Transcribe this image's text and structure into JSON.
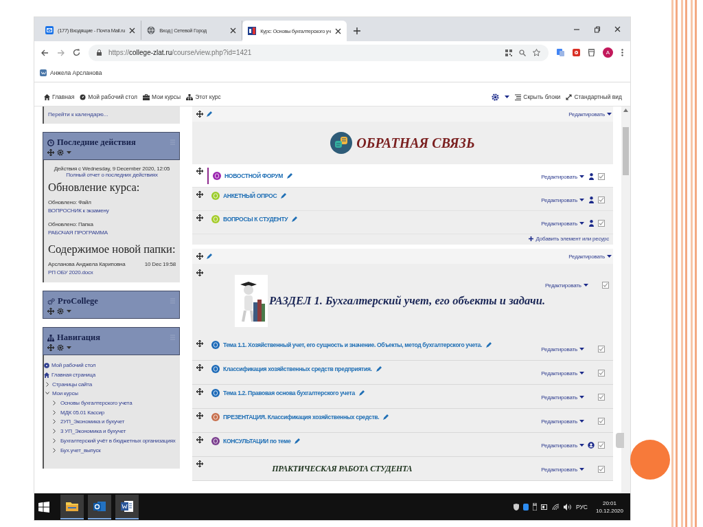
{
  "browser": {
    "tabs": [
      {
        "title": "(177) Входящие - Почта Mail.ru",
        "selected": false
      },
      {
        "title": "Вход | Сетевой Город",
        "selected": false
      },
      {
        "title": "Курс: Основы бухгалтерского уч",
        "selected": true
      }
    ],
    "url": {
      "scheme": "https://",
      "host": "college-zlat.ru",
      "path": "/course/view.php?id=1421"
    },
    "profile_initial": "A",
    "bookmarks": [
      "Анжела Арсланова"
    ]
  },
  "moodle_nav": {
    "items": [
      "Главная",
      "Мой рабочий стол",
      "Мои курсы",
      "Этот курс"
    ],
    "actions": [
      "Скрыть блоки",
      "Стандартный вид"
    ]
  },
  "sidebar": {
    "calendar_link": "Перейти к календарю...",
    "blocks": [
      {
        "kind": "recent",
        "title": "Последние действия",
        "since": "Действия с Wednesday, 9 December 2020, 12:05",
        "report_link": "Полный отчет о последних действиях",
        "heading": "Обновление курса:",
        "updates": [
          {
            "label": "Обновлено: Файл",
            "link": "ВОПРОСНИК к экзамену"
          },
          {
            "label": "Обновлено: Папка",
            "link": "РАБОЧАЯ ПРОГРАММА"
          }
        ],
        "folder_heading": "Содержимое новой папки:",
        "file": {
          "author": "Арсланова Анджела Кариповна",
          "time": "10 Dec 19:58",
          "link": "РП ОБУ 2020.docx"
        }
      },
      {
        "kind": "plain",
        "title": "ProCollege"
      },
      {
        "kind": "navigation",
        "title": "Навигация",
        "items": [
          {
            "label": "Мой рабочий стол"
          },
          {
            "label": "Главная страница"
          },
          {
            "label": "Страницы сайта",
            "expanded": false
          },
          {
            "label": "Мои курсы",
            "expanded": true,
            "children": [
              {
                "label": "Основы бухгалтерского учета",
                "expanded": false
              },
              {
                "label": "МДК 05.01 Кассир",
                "expanded": false
              },
              {
                "label": "2УП_Экономика и бухучет",
                "expanded": false
              },
              {
                "label": "3 УП_Экономика и бухучет",
                "expanded": false
              },
              {
                "label": "Бухгалтерский учёт в бюджетных организациях",
                "expanded": false
              },
              {
                "label": "Бух.учет_выпуск",
                "expanded": false
              }
            ]
          }
        ]
      }
    ]
  },
  "sections": [
    {
      "kind": "feedback",
      "title": "ОБРАТНАЯ СВЯЗЬ",
      "edit": "Редактировать",
      "activities": [
        {
          "kind": "activity",
          "name": "НОВОСТНОЙ ФОРУМ",
          "color": "#9c27b0",
          "highlighted": true,
          "edit": "Редактировать",
          "role_icon": {
            "kind": "person"
          }
        },
        {
          "kind": "activity",
          "name": "АНКЕТНЫЙ ОПРОС",
          "color": "#9ccc2c",
          "highlighted": false,
          "edit": "Редактировать",
          "role_icon": {
            "kind": "person"
          }
        },
        {
          "kind": "activity",
          "name": "ВОПРОСЫ К СТУДЕНТУ",
          "color": "#a5cc2a",
          "highlighted": false,
          "edit": "Редактировать",
          "role_icon": {
            "kind": "person"
          }
        }
      ],
      "add_link": "Добавить элемент или ресурс"
    },
    {
      "kind": "topic",
      "title": "РАЗДЕЛ 1. Бухгалтерский учет, его объекты и задачи.",
      "edit": "Редактировать",
      "banner_edit": "Редактировать",
      "activities": [
        {
          "kind": "activity",
          "name": "Тема 1.1. Хозяйственный учет, его сущность и значение. Объекты, метод бухгалтерского учета.",
          "color": "#1e6bb8",
          "highlighted": false,
          "edit": "Редактировать"
        },
        {
          "kind": "activity",
          "name": "Классификация хозяйственных средств предприятия.",
          "color": "#1e6bb8",
          "highlighted": false,
          "edit": "Редактировать"
        },
        {
          "kind": "activity",
          "name": "Тема 1.2. Правовая основа бухгалтерского учета",
          "color": "#1e6bb8",
          "highlighted": false,
          "edit": "Редактировать"
        },
        {
          "kind": "activity",
          "name": "ПРЕЗЕНТАЦИЯ. Классификация хозяйственных средств.",
          "color": "#c8704e",
          "highlighted": false,
          "edit": "Редактировать"
        },
        {
          "kind": "activity",
          "name": "КОНСУЛЬТАЦИИ по теме",
          "color": "#7b3f8f",
          "highlighted": false,
          "edit": "Редактировать",
          "role_icon": {
            "kind": "round"
          }
        },
        {
          "kind": "label",
          "name": "ПРАКТИЧЕСКАЯ РАБОТА СТУДЕНТА",
          "edit": "Редактировать"
        }
      ]
    }
  ],
  "tray": {
    "language": "РУС",
    "time": "20:01",
    "date": "10.12.2020"
  }
}
